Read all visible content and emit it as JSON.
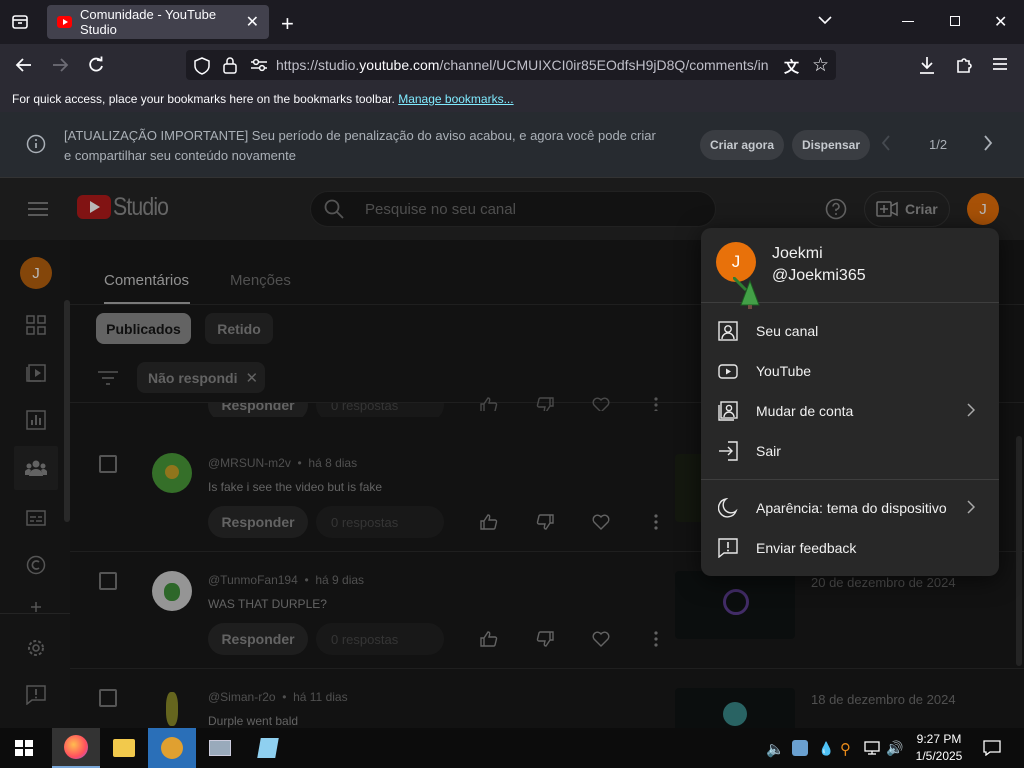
{
  "browser": {
    "tab_title": "Comunidade - YouTube Studio",
    "url_prefix": "https://studio.",
    "url_host": "youtube.com",
    "url_path": "/channel/UCMUIXCI0ir85EOdfsH9jD8Q/comments/in",
    "bookmarks_text": "For quick access, place your bookmarks here on the bookmarks toolbar.",
    "bookmarks_link": "Manage bookmarks..."
  },
  "notice": {
    "text": "[ATUALIZAÇÃO IMPORTANTE] Seu período de penalização do aviso acabou, e agora você pode criar e compartilhar seu conteúdo novamente",
    "create_now": "Criar agora",
    "dismiss": "Dispensar",
    "pager": "1/2"
  },
  "header": {
    "logo_text": "Studio",
    "search_placeholder": "Pesquise no seu canal",
    "create_label": "Criar",
    "avatar_initial": "J"
  },
  "tabs": {
    "comments": "Comentários",
    "mentions": "Menções"
  },
  "filters": {
    "published": "Publicados",
    "held": "Retido",
    "active_filter": "Não respondi"
  },
  "comments": [
    {
      "author": "@MRSUN-m2v",
      "age": "há 8 dias",
      "text": "Is fake i see the video but is fake",
      "reply": "Responder",
      "replies": "0 respostas",
      "date": ""
    },
    {
      "author": "@TunmoFan194",
      "age": "há 9 dias",
      "text": "WAS THAT DURPLE?",
      "reply": "Responder",
      "replies": "0 respostas",
      "date": "20 de dezembro de 2024"
    },
    {
      "author": "@Siman-r2o",
      "age": "há 11 dias",
      "text": "Durple went bald",
      "reply": "Responder",
      "replies": "0 respostas",
      "date": "18 de dezembro de 2024"
    }
  ],
  "partial_row": {
    "reply": "Responder",
    "replies": "0 respostas"
  },
  "menu": {
    "name": "Joekmi",
    "handle": "@Joekmi365",
    "avatar_initial": "J",
    "items": [
      {
        "label": "Seu canal",
        "icon": "person-box-icon"
      },
      {
        "label": "YouTube",
        "icon": "youtube-play-icon"
      },
      {
        "label": "Mudar de conta",
        "icon": "switch-account-icon"
      },
      {
        "label": "Sair",
        "icon": "sign-out-icon"
      },
      {
        "label": "Aparência: tema do dispositivo",
        "icon": "moon-icon"
      },
      {
        "label": "Enviar feedback",
        "icon": "feedback-icon"
      }
    ]
  },
  "taskbar": {
    "time": "9:27 PM",
    "date": "1/5/2025"
  },
  "colors": {
    "accent_avatar": "#e8710a",
    "yt_red": "#ff0000",
    "link": "#80ebff"
  }
}
